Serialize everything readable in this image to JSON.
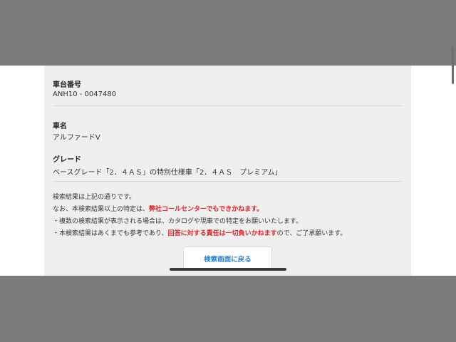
{
  "vehicle": {
    "chassis_label": "車台番号",
    "chassis_value": "ANH10 - 0047480",
    "name_label": "車名",
    "name_value": "アルファードV",
    "grade_label": "グレード",
    "grade_value": "ベースグレード「2．４ＡＳ」の特別仕様車「2．４ＡＳ　プレミアム」"
  },
  "notes": {
    "line1": "検索結果は上記の通りです。",
    "line2_pre": "なお、本検索結果以上の特定は、",
    "line2_red": "弊社コールセンターでもできかねます。",
    "line3": "・複数の検索結果が表示される場合は、カタログや現車での特定をお願いいたします。",
    "line4_pre": "・本検索結果はあくまでも参考であり、",
    "line4_red": "回答に対する責任は一切負いかねます",
    "line4_post": "ので、ご了承願います。"
  },
  "actions": {
    "back_label": "検索画面に戻る"
  },
  "colors": {
    "accent_red": "#e0242a",
    "link_blue": "#2f7fd1"
  }
}
